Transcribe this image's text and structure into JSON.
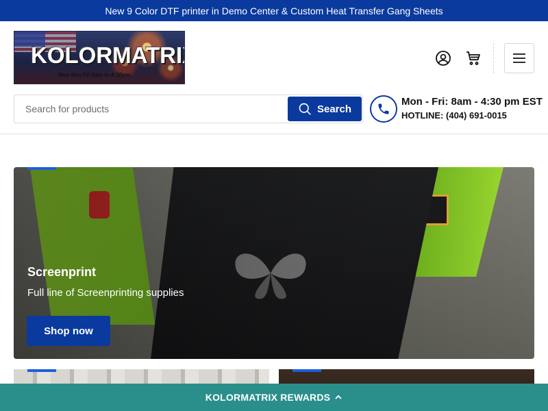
{
  "announcement": {
    "text": "New 9 Color DTF printer in Demo Center & Custom Heat Transfer Gang Sheets"
  },
  "logo": {
    "brand": "KOLORMATRIX",
    "hours": "Mon thru Fri 8am to 4:30pm"
  },
  "header": {
    "account_icon": "user-icon",
    "cart_icon": "cart-icon",
    "menu_icon": "hamburger-icon"
  },
  "search": {
    "placeholder": "Search for products",
    "value": "",
    "button_label": "Search"
  },
  "contact": {
    "hours": "Mon - Fri: 8am - 4:30 pm EST",
    "hotline_label": "HOTLINE:",
    "hotline_number": "(404) 691-0015"
  },
  "hero": {
    "title": "Screenprint",
    "subtitle": "Full line of Screenprinting supplies",
    "button_label": "Shop now"
  },
  "rewards": {
    "label": "KOLORMATRIX REWARDS"
  },
  "colors": {
    "primary": "#0a3a9e",
    "rewards_bar": "#2a8f8b",
    "accent_tag": "#1d5fdc"
  }
}
